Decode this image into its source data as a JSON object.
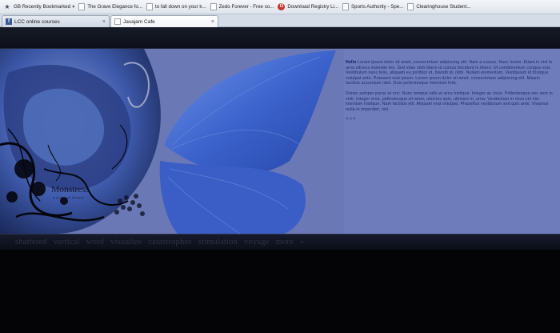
{
  "bookmarks": [
    {
      "icon": "star-icon",
      "label": "GB Recently Bookmarked",
      "chevron": "▾"
    },
    {
      "icon": "page-icon",
      "label": "The Grave Elegance fo..."
    },
    {
      "icon": "page-icon",
      "label": "to fall down on your k..."
    },
    {
      "icon": "page-icon",
      "label": "Zedo Forever - Free so..."
    },
    {
      "icon": "opera-icon",
      "label": "Download Registry Li..."
    },
    {
      "icon": "page-icon",
      "label": "Sports Authority - Spe..."
    },
    {
      "icon": "page-icon",
      "label": "Clearinghouse Student..."
    }
  ],
  "tabs": [
    {
      "label": "LCC online courses",
      "favicon": "fb"
    },
    {
      "label": "Javajam Cafe",
      "favicon": "doc"
    }
  ],
  "tab_close": "×",
  "banner": {
    "title": "Monstress",
    "subtitle": "a place of beauty",
    "paragraph1_lead": "Hello",
    "paragraph1": "Lorem ipsum dolor sit amet, consectetuer adipiscing elit. Nam a cursus. Nunc lorem. Etiam in nisl in urna ultrices molestie leo. Sed vitae nibh libero id cursus tincidunt in libero. Ut condimentum congue erat. Vestibulum nunc felis, aliquam eu porttitor id, blandit id, nibh. Nullam elementum. Vestibulum id tristique volutpat ante. Praesent erat ipsum. Lorem ipsum dolor sit amet, consectetuer adipiscing elit. Mauris facilisis accumsan nibh. Duis pellentesque interdum felis.",
    "paragraph2": "Donec semper purus et orci. Nunc tempus odio et arcu tristique. Integer ac risus. Pellentesque nec sem in velit. Integer eros, pellentesque sit amet, ultricies quis, ultricies in, urna. Vestibulum in risus vel nisi interdum tristique. Nam facilisis elit. Aliquam erat volutpat. Phasellus vestibulum sed quis ante. Vivamus nulla in imperdiet, nisl.",
    "more": "<<<"
  },
  "nav": [
    "shattered",
    "vertical",
    "word",
    "visualize",
    "catastrophes",
    "stimulation",
    "voyage",
    "more",
    "»"
  ],
  "colors": {
    "banner": "#6e7cbc",
    "wing": "#3f63c9",
    "text": "#1e2a6b"
  }
}
